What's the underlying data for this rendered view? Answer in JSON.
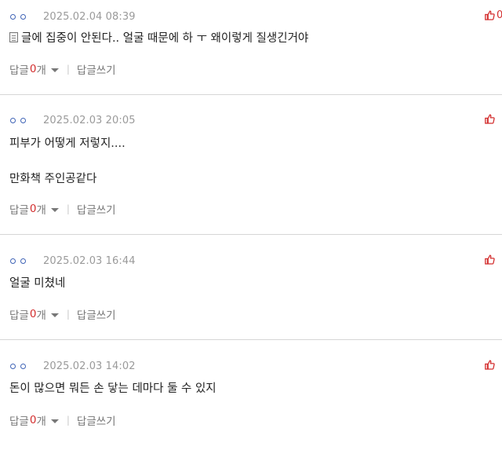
{
  "colors": {
    "accent": "#d32f2f",
    "user_dot": "#3f63b6",
    "meta_gray": "#9a9a9a",
    "divider": "#d6d6d6"
  },
  "comments": [
    {
      "date": "2025.02.04 08:39",
      "like_count": "0",
      "lines": [
        "글에 집중이 안된다.. 얼굴 때문에 하 ㅜ 왜이렇게 질생긴거야"
      ],
      "reply_label": "답글",
      "reply_count": "0",
      "reply_unit": "개",
      "write_label": "답글쓰기"
    },
    {
      "date": "2025.02.03 20:05",
      "like_count": "",
      "lines": [
        "피부가 어떻게 저렇지....",
        "만화책 주인공같다"
      ],
      "reply_label": "답글",
      "reply_count": "0",
      "reply_unit": "개",
      "write_label": "답글쓰기"
    },
    {
      "date": "2025.02.03 16:44",
      "like_count": "",
      "lines": [
        "얼굴 미쳤네"
      ],
      "reply_label": "답글",
      "reply_count": "0",
      "reply_unit": "개",
      "write_label": "답글쓰기"
    },
    {
      "date": "2025.02.03 14:02",
      "like_count": "",
      "lines": [
        "돈이 많으면 뭐든 손 닿는 데마다 둘 수 있지"
      ],
      "reply_label": "답글",
      "reply_count": "0",
      "reply_unit": "개",
      "write_label": "답글쓰기"
    }
  ],
  "icons": {
    "user_icon": "user-dots-icon",
    "like_icon": "thumbs-up-icon",
    "caret_icon": "caret-down-icon",
    "doc_icon": "document-icon"
  }
}
